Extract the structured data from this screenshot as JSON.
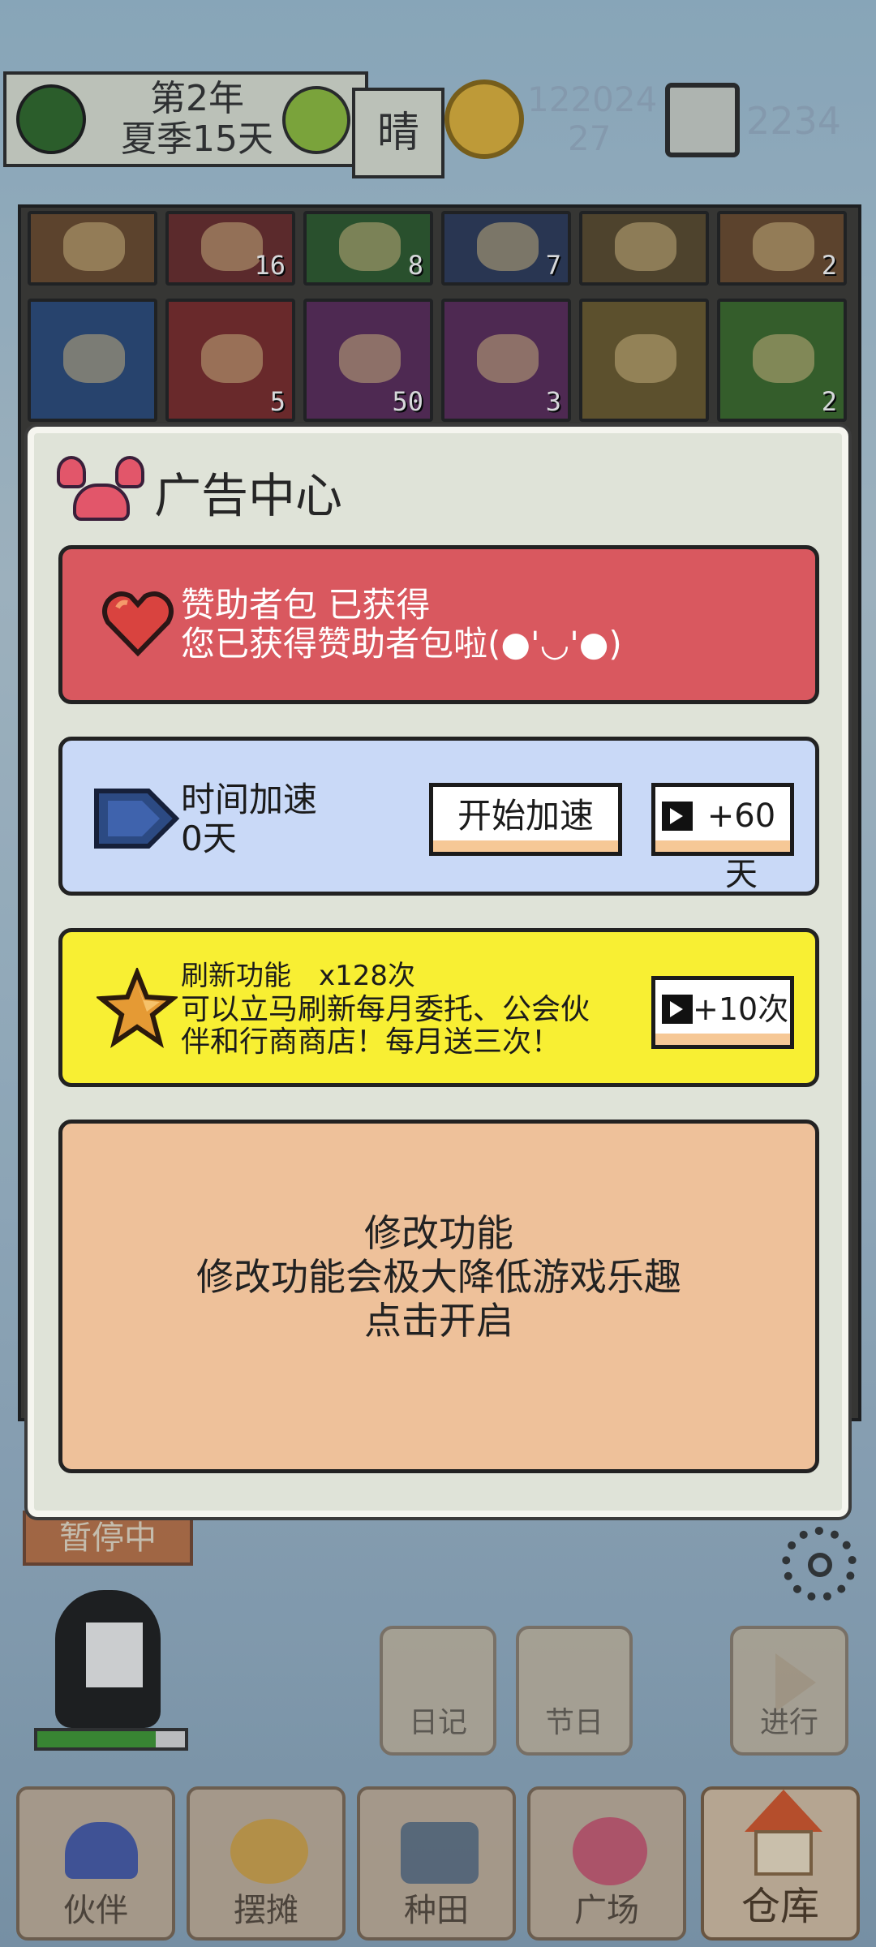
{
  "status_bar": {
    "year": "第2年",
    "season_day": "夏季15天",
    "weather": "晴",
    "money": "122024",
    "money_sub": "27",
    "storage": "2234"
  },
  "inventory": {
    "row1_counts": [
      "",
      "16",
      "8",
      "7",
      "",
      "2"
    ],
    "row2_counts": [
      "",
      "5",
      "50",
      "3",
      "",
      "2"
    ]
  },
  "ad_center": {
    "title": "广告中心",
    "sponsor": {
      "title": "赞助者包 已获得",
      "desc": "您已获得赞助者包啦(●'◡'●)",
      "color": "#d9585f"
    },
    "speedup": {
      "title": "时间加速",
      "days": "0天",
      "start_button": "开始加速",
      "ad_button": "+60天",
      "color": "#c9d9f7"
    },
    "refresh": {
      "title": "刷新功能",
      "count": "x128次",
      "desc_line1": "可以立马刷新每月委托、公会伙",
      "desc_line2": "伴和行商商店！每月送三次！",
      "ad_button": "+10次",
      "color": "#f8ef33"
    },
    "modify": {
      "title": "修改功能",
      "desc": "修改功能会极大降低游戏乐趣",
      "action": "点击开启",
      "color": "#eec19a"
    }
  },
  "paused_label": "暂停中",
  "actions": {
    "diary": "日记",
    "festival": "节日",
    "proceed": "进行"
  },
  "tabs": [
    "伙伴",
    "摆摊",
    "种田",
    "广场",
    "仓库"
  ],
  "icons": {
    "settings": "gear-icon",
    "video": "video-ad-icon",
    "crab": "crab-icon",
    "heart": "heart-icon",
    "speed": "fast-forward-icon",
    "star": "star-icon"
  }
}
